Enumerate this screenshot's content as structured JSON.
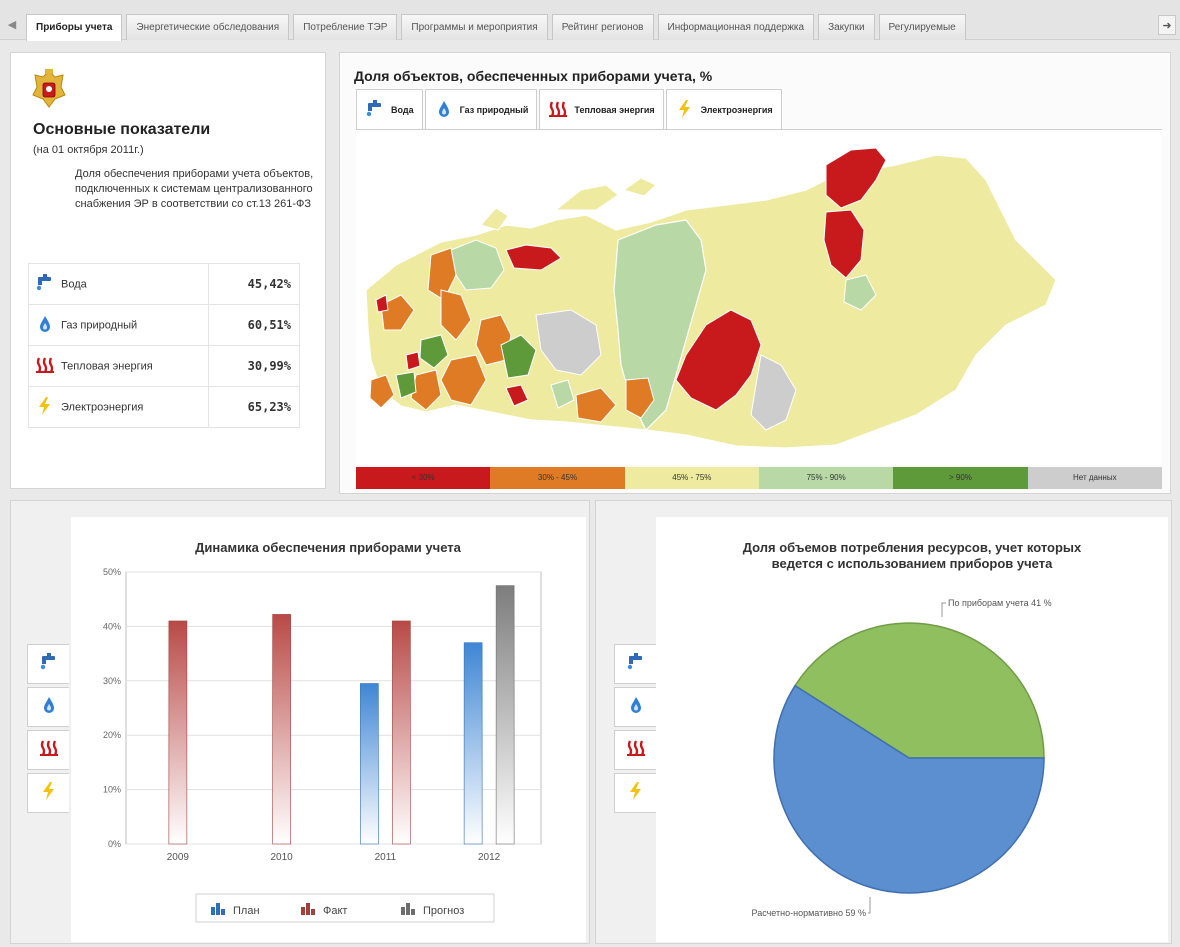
{
  "tabbar": {
    "tabs": [
      {
        "label": "Приборы учета",
        "active": true
      },
      {
        "label": "Энергетические обследования",
        "active": false
      },
      {
        "label": "Потребление ТЭР",
        "active": false
      },
      {
        "label": "Программы и мероприятия",
        "active": false
      },
      {
        "label": "Рейтинг регионов",
        "active": false
      },
      {
        "label": "Информационная поддержка",
        "active": false
      },
      {
        "label": "Закупки",
        "active": false
      },
      {
        "label": "Регулируемые",
        "active": false
      }
    ],
    "scroll_left_icon": "arrow-left-icon",
    "scroll_right_icon": "arrow-right-icon"
  },
  "stats": {
    "title": "Основные показатели",
    "date": "(на 01 октября 2011г.)",
    "description": "Доля обеспечения приборами учета объектов, подключенных к системам централизованного снабжения ЭР в соответствии со ст.13 261-ФЗ",
    "rows": [
      {
        "icon": "water-tap-icon",
        "label": "Вода",
        "value": "45,42%"
      },
      {
        "icon": "gas-flame-icon",
        "label": "Газ природный",
        "value": "60,51%"
      },
      {
        "icon": "heat-icon",
        "label": "Тепловая энергия",
        "value": "30,99%"
      },
      {
        "icon": "lightning-icon",
        "label": "Электроэнергия",
        "value": "65,23%"
      }
    ]
  },
  "map": {
    "title": "Доля объектов, обеспеченных приборами учета, %",
    "tabs": [
      {
        "icon": "water-tap-icon",
        "label": "Вода",
        "active": true
      },
      {
        "icon": "gas-flame-icon",
        "label": "Газ природный",
        "active": false
      },
      {
        "icon": "heat-icon",
        "label": "Тепловая энергия",
        "active": false
      },
      {
        "icon": "lightning-icon",
        "label": "Электроэнергия",
        "active": false
      }
    ],
    "legend": [
      {
        "label": "< 30%",
        "color": "#c8191c"
      },
      {
        "label": "30% - 45%",
        "color": "#e07b25"
      },
      {
        "label": "45% - 75%",
        "color": "#eeeaa0"
      },
      {
        "label": "75% - 90%",
        "color": "#b8d9a6"
      },
      {
        "label": "> 90%",
        "color": "#5f9a3a"
      },
      {
        "label": "Нет данных",
        "color": "#cdcdcd"
      }
    ]
  },
  "resource_tabs": [
    "water-tap-icon",
    "gas-flame-icon",
    "heat-icon",
    "lightning-icon"
  ],
  "chart_data": [
    {
      "type": "bar",
      "title": "Динамика обеспечения приборами учета",
      "categories": [
        "2009",
        "2010",
        "2011",
        "2012"
      ],
      "ylim": [
        0,
        50
      ],
      "yticks": [
        "0%",
        "10%",
        "20%",
        "30%",
        "40%",
        "50%"
      ],
      "grid": true,
      "legend_position": "bottom",
      "series": [
        {
          "name": "План",
          "color": "#4a90d9",
          "values": [
            null,
            null,
            29.5,
            37
          ]
        },
        {
          "name": "Факт",
          "color": "#c0504d",
          "values": [
            41,
            42.2,
            41,
            null
          ]
        },
        {
          "name": "Прогноз",
          "color": "#8c8c8c",
          "values": [
            null,
            null,
            null,
            47.5
          ]
        }
      ]
    },
    {
      "type": "pie",
      "title": "Доля объемов потребления ресурсов, учет которых ведется с использованием приборов учета",
      "slices": [
        {
          "name": "По приборам учета",
          "value": 41,
          "label": "По приборам учета 41 %",
          "color": "#8fbf5f"
        },
        {
          "name": "Расчетно-нормативно",
          "value": 59,
          "label": "Расчетно-нормативно 59 %",
          "color": "#5b8fd0"
        }
      ]
    }
  ]
}
